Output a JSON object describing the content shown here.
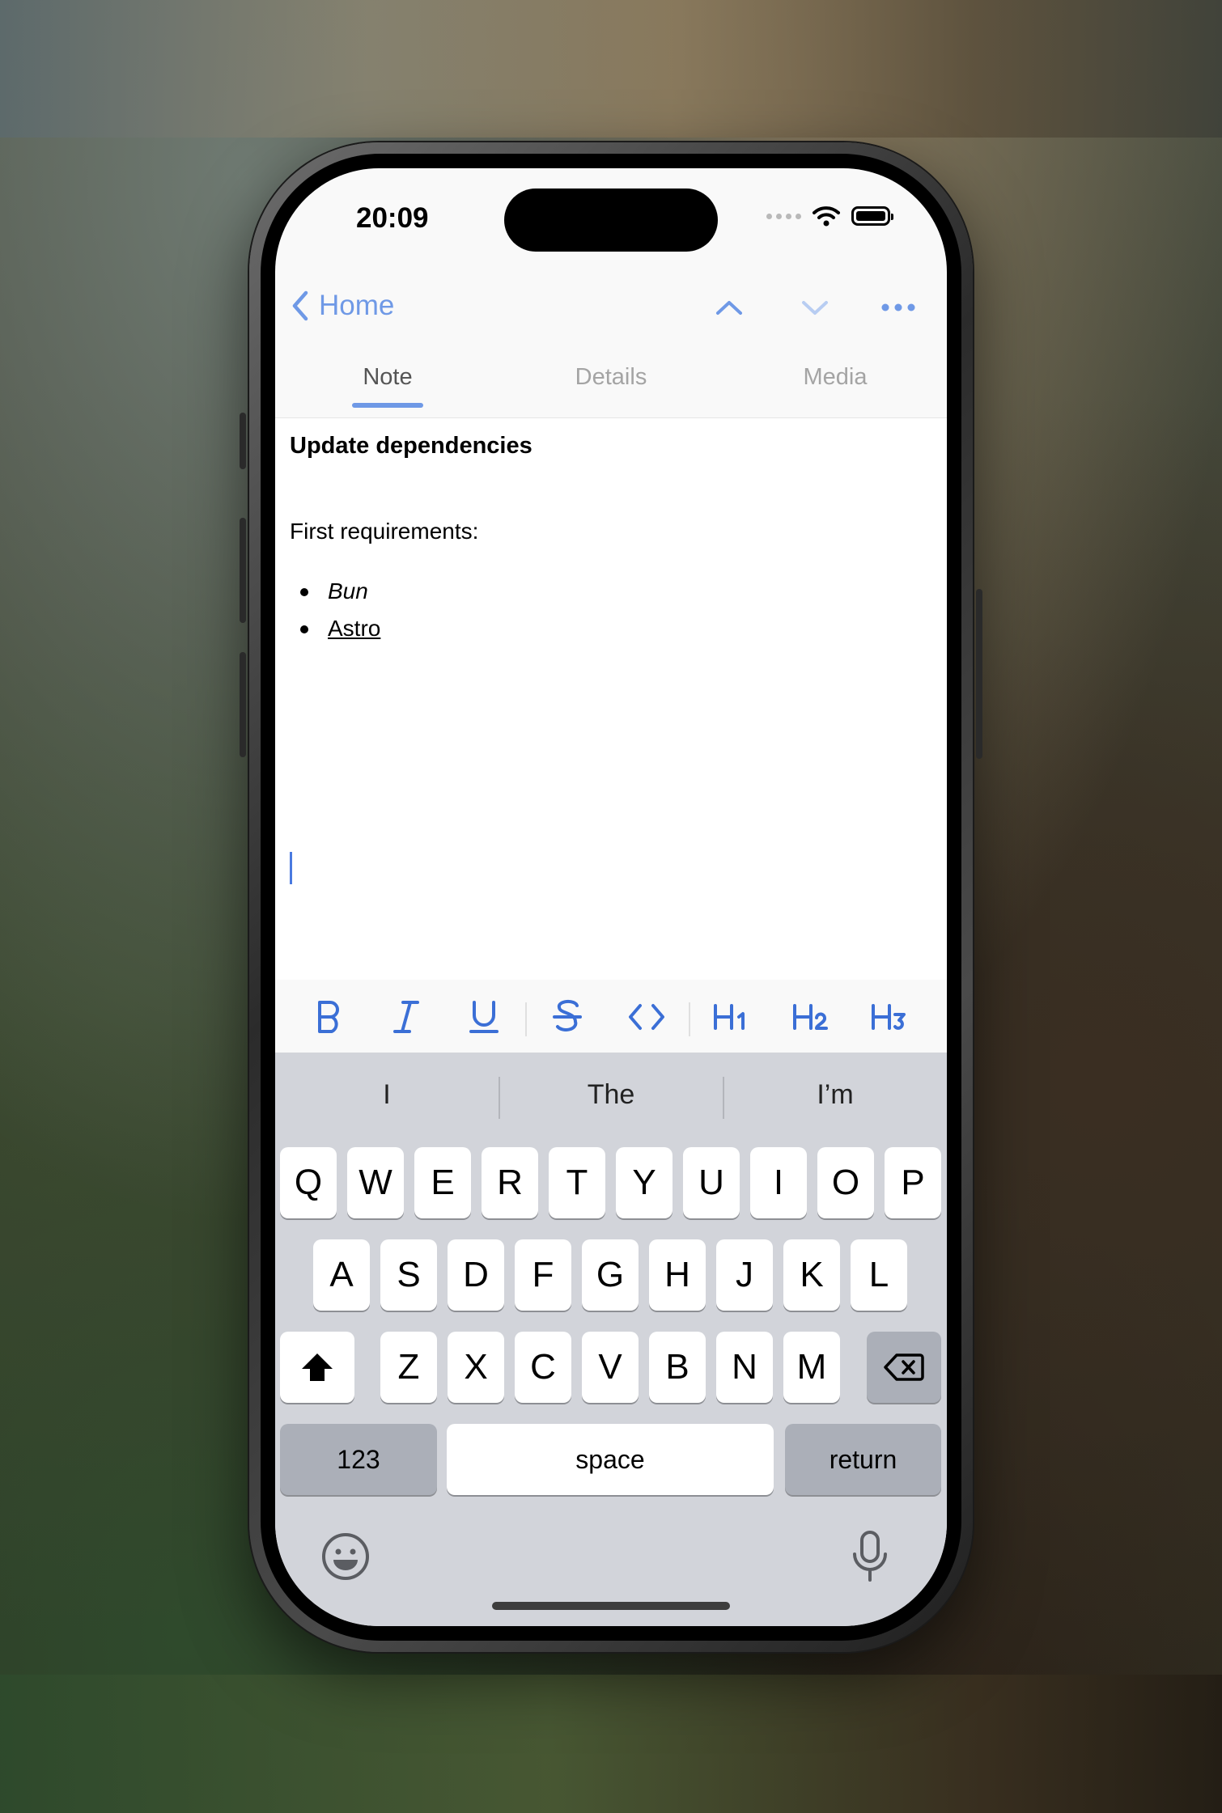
{
  "status": {
    "time": "20:09"
  },
  "nav": {
    "back_label": "Home"
  },
  "tabs": [
    {
      "label": "Note",
      "active": true
    },
    {
      "label": "Details",
      "active": false
    },
    {
      "label": "Media",
      "active": false
    }
  ],
  "note": {
    "title": "Update dependencies",
    "paragraph": "First requirements:",
    "bullets": [
      {
        "text": "Bun",
        "style": "italic"
      },
      {
        "text": "Astro",
        "style": "underline"
      }
    ]
  },
  "format_toolbar": {
    "bold": "B",
    "italic": "I",
    "underline": "U",
    "h1": "H1",
    "h2": "H2",
    "h3": "H3"
  },
  "keyboard": {
    "suggestions": [
      "I",
      "The",
      "I’m"
    ],
    "row1": [
      "Q",
      "W",
      "E",
      "R",
      "T",
      "Y",
      "U",
      "I",
      "O",
      "P"
    ],
    "row2": [
      "A",
      "S",
      "D",
      "F",
      "G",
      "H",
      "J",
      "K",
      "L"
    ],
    "row3": [
      "Z",
      "X",
      "C",
      "V",
      "B",
      "N",
      "M"
    ],
    "numbers_label": "123",
    "space_label": "space",
    "return_label": "return"
  },
  "colors": {
    "accent": "#6f99e6",
    "toolbar_icon": "#3b6fd6",
    "caret": "#4a7ae0"
  }
}
